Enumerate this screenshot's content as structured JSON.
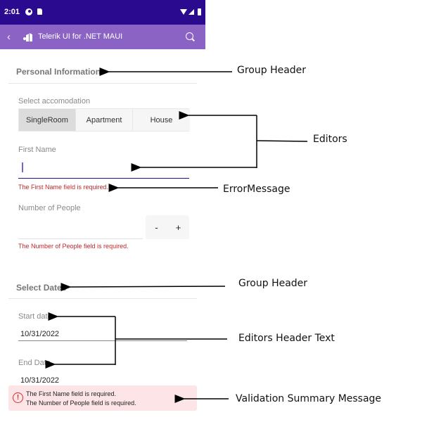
{
  "status_bar": {
    "time": "2:01"
  },
  "app_bar": {
    "title": "Telerik UI for .NET MAUI",
    "back_icon": "chevron-left-icon",
    "search_icon": "search-icon"
  },
  "groups": [
    {
      "header": "Personal Information"
    },
    {
      "header": "Select Dates"
    }
  ],
  "accommodation": {
    "label": "Select accomodation",
    "options": [
      "SingleRoom",
      "Apartment",
      "House"
    ],
    "selected": "SingleRoom"
  },
  "first_name": {
    "label": "First Name",
    "value": "",
    "error": "The First Name field is required."
  },
  "number_of_people": {
    "label": "Number of People",
    "value": "",
    "minus": "-",
    "plus": "+",
    "error": "The Number of People field is required."
  },
  "start_date": {
    "label": "Start date",
    "value": "10/31/2022"
  },
  "end_date": {
    "label": "End Date",
    "value": "10/31/2022"
  },
  "validation_summary": {
    "icon": "!",
    "messages": [
      "The First Name field is required.",
      "The Number of People field is required."
    ]
  },
  "annotations": {
    "group_header_1": "Group Header",
    "editors": "Editors",
    "error_message": "ErrorMessage",
    "group_header_2": "Group Header",
    "editors_header_text": "Editors Header Text",
    "validation_summary_message": "Validation Summary Message"
  }
}
